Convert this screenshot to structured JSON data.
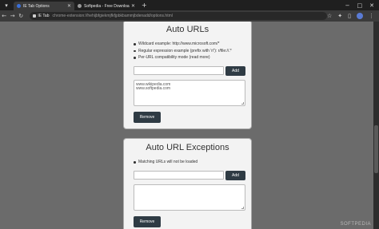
{
  "browser": {
    "tabs": [
      {
        "title": "IE Tab Options",
        "active": true,
        "favicon_color": "#3a6fd8"
      },
      {
        "title": "Softpedia - Free Downloads E...",
        "active": false,
        "favicon_color": "#9a9a9a"
      }
    ],
    "new_tab": "+",
    "address": {
      "chip": "IE Tab",
      "url": "chrome-extension://hehijbfgiekmjfkfjpbkbammjbdenadd/options.html"
    },
    "window_controls": {
      "minimize": "−",
      "maximize": "□",
      "close": "✕"
    }
  },
  "auto_urls": {
    "title": "Auto URLs",
    "bullets": [
      "Wildcard example: http://www.microsoft.com/*",
      "Regular expression example (prefix with 'r/'): r/file://.*",
      "Per-URL compatibility mode"
    ],
    "read_more": "(read more)",
    "input_value": "",
    "add_label": "Add",
    "list_lines": [
      "www.wikipedia.com",
      "www.softpedia.com"
    ],
    "remove_label": "Remove"
  },
  "auto_url_exceptions": {
    "title": "Auto URL Exceptions",
    "bullets": [
      "Matching URLs will not be loaded"
    ],
    "input_value": "",
    "add_label": "Add",
    "list_lines": [],
    "remove_label": "Remove"
  },
  "watermark": "SOFTPEDIA"
}
